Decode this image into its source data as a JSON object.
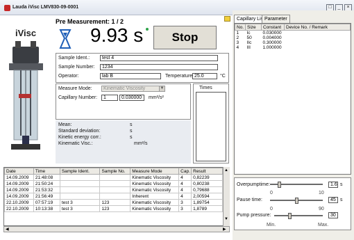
{
  "window": {
    "title": "Lauda iVisc  LMV830-09-0001"
  },
  "brand": {
    "name": "iVisc"
  },
  "measurement": {
    "status": "Pre Measurement: 1 / 2",
    "time": "9.93 s",
    "stop_label": "Stop"
  },
  "sample": {
    "ident_label": "Sample Ident.:",
    "ident_value": "test 4",
    "number_label": "Sample Number:",
    "number_value": "1234",
    "operator_label": "Operator:",
    "operator_value": "lab B",
    "temperature_label": "Temperature:",
    "temperature_value": "25.0",
    "temperature_unit": "°C"
  },
  "mode": {
    "measure_mode_label": "Measure Mode:",
    "measure_mode_value": "Kinematic Viscosity",
    "capillary_label": "Capillary Number:",
    "capillary_number": "1",
    "capillary_constant": "0.030000",
    "constant_unit": "mm²/s²",
    "times_label": "Times"
  },
  "results": {
    "mean_label": "Mean:",
    "mean_unit": "s",
    "stddev_label": "Standard deviation:",
    "stddev_unit": "s",
    "kinetic_label": "Kinetic energy corr.:",
    "kinetic_unit": "s",
    "kinvisc_label": "Kinematic Visc.:",
    "kinvisc_unit": "mm²/s"
  },
  "history": {
    "headers": [
      "Date",
      "Time",
      "Sample Ident.",
      "Sample No.",
      "Measure Mode",
      "Cap.",
      "Result"
    ],
    "rows": [
      [
        "14.09.2009",
        "21:48:08",
        "",
        "",
        "Kinematic Viscosity",
        "4",
        "0,82239"
      ],
      [
        "14.09.2009",
        "21:50:24",
        "",
        "",
        "Kinematic Viscosity",
        "4",
        "0,80238"
      ],
      [
        "14.09.2009",
        "21:53:32",
        "",
        "",
        "Kinematic Viscosity",
        "4",
        "0,79688"
      ],
      [
        "14.09.2009",
        "21:56:49",
        "",
        "",
        "Inherent",
        "4",
        "2,00594"
      ],
      [
        "22.10.2009",
        "07:57:19",
        "test 3",
        "123",
        "Kinematic Viscosity",
        "3",
        "1,89754"
      ],
      [
        "22.10.2009",
        "10:13:38",
        "test 3",
        "123",
        "Kinematic Viscosity",
        "3",
        "1,8789"
      ]
    ]
  },
  "tabs": {
    "capillary_list": "Capillary List",
    "parameter": "Parameter"
  },
  "capillaries": {
    "headers": [
      "No.",
      "Size",
      "Constant",
      "Device No. / Remark"
    ],
    "rows": [
      [
        "1",
        "Ic",
        "0.030000",
        ""
      ],
      [
        "2",
        "50",
        "0.004000",
        ""
      ],
      [
        "3",
        "IIc",
        "0.300000",
        ""
      ],
      [
        "4",
        "III",
        "1.000000",
        ""
      ]
    ]
  },
  "settings": {
    "overpump_label": "Overpumptime:",
    "overpump_value": "1.6",
    "overpump_unit": "s",
    "overpump_min": "0",
    "overpump_max": "10",
    "overpump_level": 0.16,
    "pause_label": "Pause time:",
    "pause_value": "45",
    "pause_unit": "s",
    "pause_min": "0",
    "pause_max": "90",
    "pause_level": 0.5,
    "pump_label": "Pump pressure:",
    "pump_value": "30",
    "pump_min_label": "Min.",
    "pump_max_label": "Max.",
    "pump_level": 0.3
  }
}
